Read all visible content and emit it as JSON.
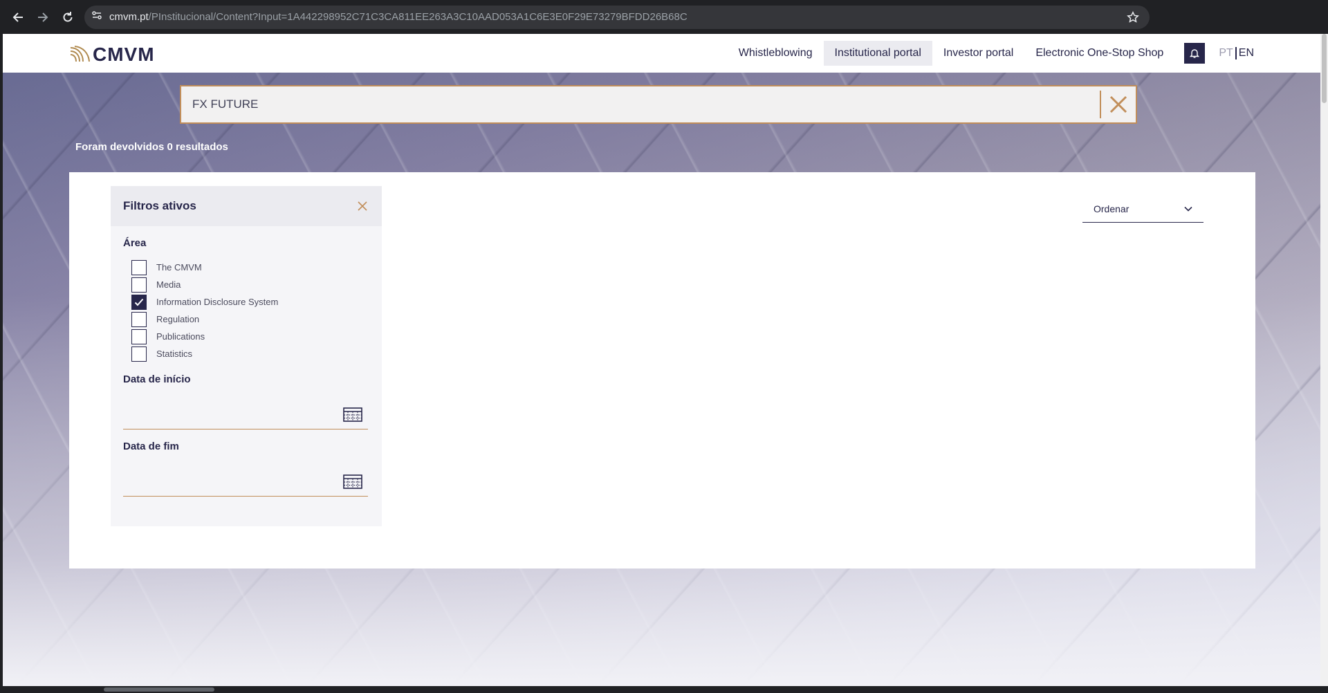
{
  "browser": {
    "url_domain": "cmvm.pt",
    "url_path": "/PInstitucional/Content?Input=1A442298952C71C3CA811EE263A3C10AAD053A1C6E3E0F29E73279BFDD26B68C"
  },
  "header": {
    "logo_text": "CMVM",
    "nav": [
      "Whistleblowing",
      "Institutional portal",
      "Investor portal",
      "Electronic One-Stop Shop"
    ],
    "lang_pt": "PT",
    "lang_en": "EN"
  },
  "search": {
    "value": "FX FUTURE"
  },
  "results_count": "Foram devolvidos 0 resultados",
  "filters": {
    "title": "Filtros ativos",
    "area_title": "Área",
    "areas": [
      {
        "label": "The CMVM",
        "checked": false
      },
      {
        "label": "Media",
        "checked": false
      },
      {
        "label": "Information Disclosure System",
        "checked": true
      },
      {
        "label": "Regulation",
        "checked": false
      },
      {
        "label": "Publications",
        "checked": false
      },
      {
        "label": "Statistics",
        "checked": false
      }
    ],
    "start_date_label": "Data de início",
    "start_date_value": "",
    "end_date_label": "Data de fim",
    "end_date_value": ""
  },
  "sort": {
    "label": "Ordenar"
  },
  "colors": {
    "navy": "#27264a",
    "accent": "#c18e5a"
  }
}
